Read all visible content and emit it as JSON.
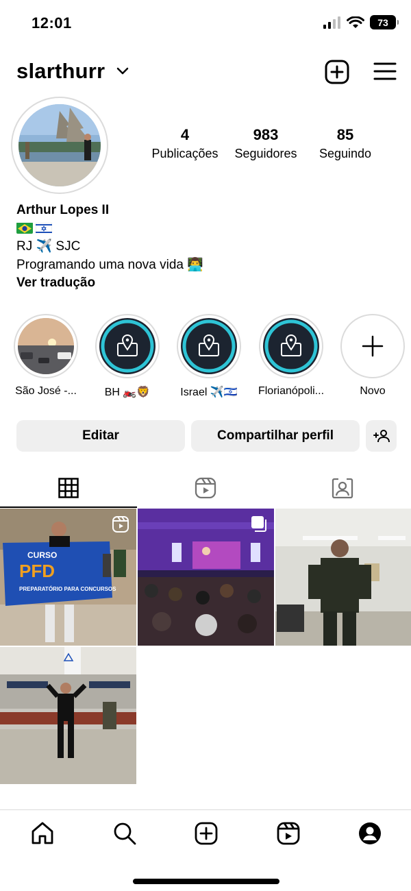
{
  "status_bar": {
    "time": "12:01",
    "battery": "73"
  },
  "profile": {
    "username": "slarthurr",
    "stats": [
      {
        "value": "4",
        "label": "Publicações"
      },
      {
        "value": "983",
        "label": "Seguidores"
      },
      {
        "value": "85",
        "label": "Seguindo"
      }
    ],
    "name": "Arthur Lopes II",
    "bio_flags": [
      "brazil-flag",
      "israel-flag"
    ],
    "bio_line_route": "RJ ✈️ SJC",
    "bio_line_text": "Programando uma nova vida 👨‍💻",
    "translate_link": "Ver tradução"
  },
  "highlights": [
    {
      "label": "São José -...",
      "kind": "photo"
    },
    {
      "label": "BH 🏍️🦁",
      "kind": "location"
    },
    {
      "label": "Israel ✈️🇮🇱",
      "kind": "location"
    },
    {
      "label": "Florianópoli...",
      "kind": "location"
    },
    {
      "label": "Novo",
      "kind": "new"
    }
  ],
  "buttons": {
    "edit": "Editar",
    "share": "Compartilhar perfil"
  },
  "tabs": [
    "grid-icon",
    "reels-icon",
    "tagged-icon"
  ],
  "grid_posts": [
    {
      "type": "reel"
    },
    {
      "type": "carousel"
    },
    {
      "type": "photo"
    },
    {
      "type": "photo"
    }
  ],
  "bottom_nav": [
    "home-icon",
    "search-icon",
    "create-icon",
    "reels-icon",
    "profile-icon"
  ],
  "colors": {
    "button_bg": "#efefef",
    "divider": "#dbdbdb",
    "highlight_teal": "#2ec4d6",
    "highlight_dark": "#1c2430"
  }
}
